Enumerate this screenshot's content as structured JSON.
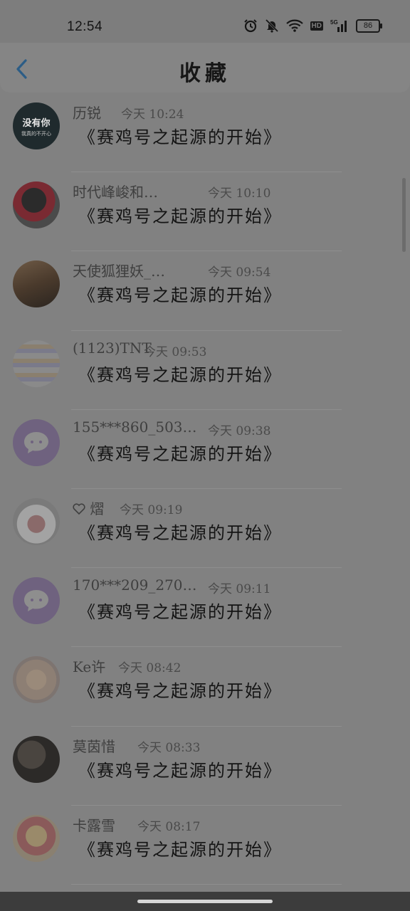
{
  "status": {
    "time": "12:54",
    "battery": "86",
    "hd": "HD",
    "network": "5G"
  },
  "header": {
    "title": "收藏"
  },
  "items": [
    {
      "name": "历锐",
      "time": "今天 10:24",
      "message": "《赛鸡号之起源的开始》",
      "avatar_text": "没有你",
      "avatar_sub": "我真的不开心"
    },
    {
      "name": "时代峰峻和…",
      "time": "今天 10:10",
      "message": "《赛鸡号之起源的开始》"
    },
    {
      "name": "天使狐狸妖_…",
      "time": "今天 09:54",
      "message": "《赛鸡号之起源的开始》"
    },
    {
      "name": "(1123)TNT",
      "time": "今天 09:53",
      "message": "《赛鸡号之起源的开始》"
    },
    {
      "name": "155***860_503…",
      "time": "今天 09:38",
      "message": "《赛鸡号之起源的开始》"
    },
    {
      "name": "熠",
      "time": "今天 09:19",
      "message": "《赛鸡号之起源的开始》"
    },
    {
      "name": "170***209_270…",
      "time": "今天 09:11",
      "message": "《赛鸡号之起源的开始》"
    },
    {
      "name": "Ke许",
      "time": "今天 08:42",
      "message": "《赛鸡号之起源的开始》"
    },
    {
      "name": "莫茵惜",
      "time": "今天 08:33",
      "message": "《赛鸡号之起源的开始》"
    },
    {
      "name": "卡露雪",
      "time": "今天 08:17",
      "message": "《赛鸡号之起源的开始》"
    }
  ]
}
